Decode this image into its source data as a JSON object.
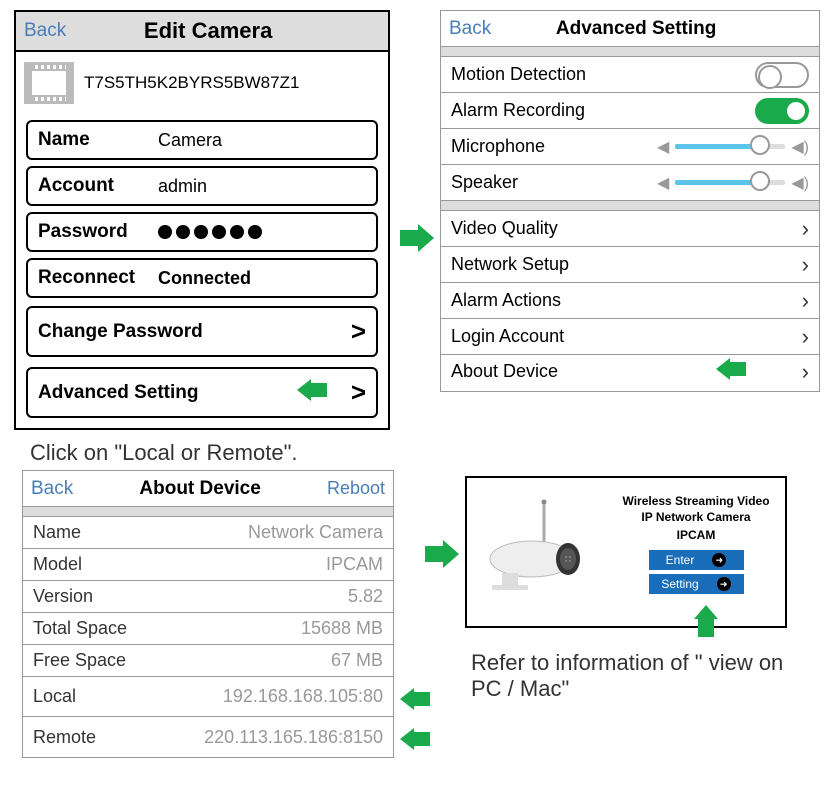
{
  "edit_camera": {
    "back": "Back",
    "title": "Edit Camera",
    "device_id": "T7S5TH5K2BYRS5BW87Z1",
    "fields": {
      "name_label": "Name",
      "name_value": "Camera",
      "account_label": "Account",
      "account_value": "admin",
      "password_label": "Password",
      "reconnect_label": "Reconnect",
      "reconnect_value": "Connected"
    },
    "change_password": "Change Password",
    "advanced_setting": "Advanced Setting"
  },
  "advanced": {
    "back": "Back",
    "title": "Advanced Setting",
    "motion_detection": "Motion Detection",
    "alarm_recording": "Alarm Recording",
    "microphone": "Microphone",
    "speaker": "Speaker",
    "video_quality": "Video Quality",
    "network_setup": "Network Setup",
    "alarm_actions": "Alarm Actions",
    "login_account": "Login Account",
    "about_device": "About Device"
  },
  "instruction1": "Click on \"Local or Remote\".",
  "about": {
    "back": "Back",
    "title": "About Device",
    "reboot": "Reboot",
    "rows": {
      "name_label": "Name",
      "name_value": "Network Camera",
      "model_label": "Model",
      "model_value": "IPCAM",
      "version_label": "Version",
      "version_value": "5.82",
      "total_label": "Total Space",
      "total_value": "15688 MB",
      "free_label": "Free Space",
      "free_value": "67 MB",
      "local_label": "Local",
      "local_value": "192.168.168.105:80",
      "remote_label": "Remote",
      "remote_value": "220.113.165.186:8150"
    }
  },
  "web": {
    "title1": "Wireless Streaming Video",
    "title2": "IP Network Camera",
    "model": "IPCAM",
    "enter": "Enter",
    "setting": "Setting"
  },
  "instruction2": "Refer to information of \" view on PC / Mac\""
}
